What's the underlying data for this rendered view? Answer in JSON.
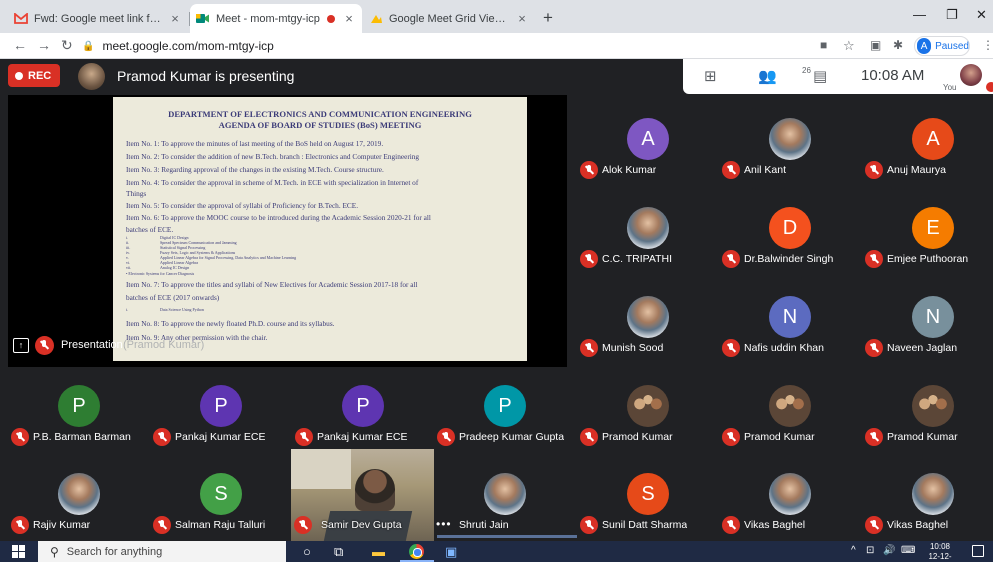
{
  "browser": {
    "tabs": [
      {
        "title": "Fwd: Google meet link for BoS - ",
        "favicon": "gmail-icon"
      },
      {
        "title": "Meet - mom-mtgy-icp",
        "favicon": "meet-icon",
        "active": true
      },
      {
        "title": "Google Meet Grid View (fix) - Ch",
        "favicon": "extension-icon"
      }
    ],
    "url": "meet.google.com/mom-mtgy-icp",
    "profile_initial": "A",
    "profile_status": "Paused"
  },
  "meet": {
    "rec_label": "REC",
    "presenting_text": "Pramod Kumar is presenting",
    "participant_count": "26",
    "time": "10:08 AM",
    "you_label": "You",
    "presentation_label": "Presentation",
    "presentation_ghost_label": "(Pramod Kumar)"
  },
  "slide": {
    "title": "DEPARTMENT OF ELECTRONICS AND COMMUNICATION ENGINEERING",
    "subtitle": "AGENDA OF BOARD OF STUDIES (BoS) MEETING",
    "lines": [
      "Item No. 1: To approve the minutes of last meeting of the BoS held on August 17, 2019.",
      "Item No. 2: To consider the addition of new B.Tech. branch : Electronics and Computer Engineering",
      "Item No. 3: Regarding approval of the changes in the existing M.Tech. Course structure.",
      "Item No. 4: To consider the approval in scheme of M.Tech. in ECE with specialization in Internet of",
      "Things",
      "Item No. 5: To consider the approval of syllabi of Proficiency for B.Tech. ECE.",
      "Item No. 6: To approve the MOOC course to be introduced during the Academic Session 2020-21 for all",
      "batches of ECE."
    ],
    "sub_items": [
      {
        "num": "i.",
        "text": "Digital IC Design"
      },
      {
        "num": "ii.",
        "text": "Spread Spectrum Communication and Jamming"
      },
      {
        "num": "iii.",
        "text": "Statistical Signal Processing"
      },
      {
        "num": "iv.",
        "text": "Fuzzy Sets, Logic and Systems & Applications"
      },
      {
        "num": "v.",
        "text": "Applied Linear Algebra for Signal Processing, Data Analytics and Machine Learning"
      },
      {
        "num": "vi.",
        "text": "Applied Linear Algebra"
      },
      {
        "num": "vii.",
        "text": "Analog IC Design"
      }
    ],
    "sub_extra": "• Electronic Systems for Cancer Diagnosis",
    "lines2": [
      "Item No. 7: To approve the titles and syllabi of New Electives for Academic Session 2017-18 for all",
      "batches of ECE (2017 onwards)"
    ],
    "sub_item2": {
      "num": "i.",
      "text": "Data Science Using Python"
    },
    "lines3": [
      "Item No. 8: To approve the newly floated Ph.D. course and its syllabus.",
      "Item No. 9: Any other permission with the chair."
    ]
  },
  "participants": [
    {
      "name": "Alok Kumar",
      "initial": "A",
      "color": "#7e57c2",
      "type": "initial"
    },
    {
      "name": "Anil Kant",
      "type": "photo"
    },
    {
      "name": "Anuj Maurya",
      "initial": "A",
      "color": "#e64a19",
      "type": "initial"
    },
    {
      "name": "C.C. TRIPATHI",
      "type": "photo"
    },
    {
      "name": "Dr.Balwinder Singh",
      "initial": "D",
      "color": "#f4511e",
      "type": "initial"
    },
    {
      "name": "Emjee Puthooran",
      "initial": "E",
      "color": "#f57c00",
      "type": "initial"
    },
    {
      "name": "Munish Sood",
      "type": "photo"
    },
    {
      "name": "Nafis uddin Khan",
      "initial": "N",
      "color": "#5c6bc0",
      "type": "initial"
    },
    {
      "name": "Naveen Jaglan",
      "initial": "N",
      "color": "#78909c",
      "type": "initial"
    },
    {
      "name": "P.B. Barman Barman",
      "initial": "P",
      "color": "#2e7d32",
      "type": "initial"
    },
    {
      "name": "Pankaj Kumar ECE",
      "initial": "P",
      "color": "#5e35b1",
      "type": "initial"
    },
    {
      "name": "Pankaj Kumar ECE",
      "initial": "P",
      "color": "#5e35b1",
      "type": "initial"
    },
    {
      "name": "Pradeep Kumar Gupta",
      "initial": "P",
      "color": "#0097a7",
      "type": "initial"
    },
    {
      "name": "Pramod Kumar",
      "type": "multi"
    },
    {
      "name": "Pramod Kumar",
      "type": "multi"
    },
    {
      "name": "Pramod Kumar",
      "type": "multi"
    },
    {
      "name": "Rajiv Kumar",
      "type": "photo"
    },
    {
      "name": "Salman Raju Talluri",
      "initial": "S",
      "color": "#43a047",
      "type": "initial"
    },
    {
      "name": "Shruti Jain",
      "type": "photo",
      "more": true
    },
    {
      "name": "Sunil Datt Sharma",
      "initial": "S",
      "color": "#e64a19",
      "type": "initial"
    },
    {
      "name": "Vikas Baghel",
      "type": "photo"
    },
    {
      "name": "Vikas Baghel",
      "type": "photo"
    }
  ],
  "video_tile": {
    "name": "Samir Dev Gupta"
  },
  "taskbar": {
    "search_placeholder": "Search for anything",
    "clock_time": "10:08",
    "clock_date": "12-12-2020"
  }
}
